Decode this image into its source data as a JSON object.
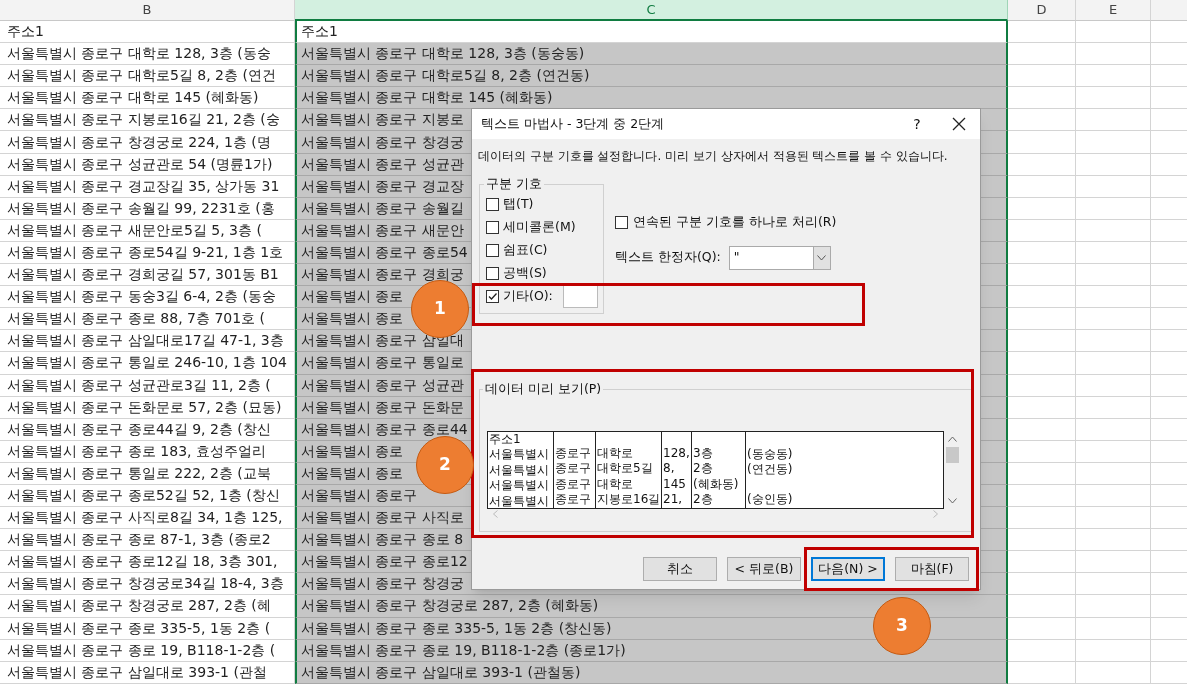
{
  "columns": [
    {
      "label": "B",
      "selected": false
    },
    {
      "label": "C",
      "selected": true
    },
    {
      "label": "D",
      "selected": false
    },
    {
      "label": "E",
      "selected": false
    }
  ],
  "header_row": {
    "b": "주소1",
    "c": "주소1"
  },
  "rows": [
    {
      "b": "서울특별시 종로구 대학로 128, 3층 (동숭",
      "c": "서울특별시 종로구 대학로 128, 3층 (동숭동)"
    },
    {
      "b": "서울특별시 종로구 대학로5길 8, 2층 (연건",
      "c": "서울특별시 종로구 대학로5길 8, 2층 (연건동)"
    },
    {
      "b": "서울특별시 종로구 대학로 145 (혜화동)",
      "c": "서울특별시 종로구 대학로 145 (혜화동)"
    },
    {
      "b": "서울특별시 종로구 지봉로16길 21, 2층 (숭",
      "c": "서울특별시 종로구 지봉로"
    },
    {
      "b": "서울특별시 종로구 창경궁로 224, 1층 (명",
      "c": "서울특별시 종로구 창경궁"
    },
    {
      "b": "서울특별시 종로구 성균관로 54 (명륜1가)",
      "c": "서울특별시 종로구 성균관"
    },
    {
      "b": "서울특별시 종로구 경교장길 35, 상가동 31",
      "c": "서울특별시 종로구 경교장"
    },
    {
      "b": "서울특별시 종로구 송월길 99, 2231호 (홍",
      "c": "서울특별시 종로구 송월길"
    },
    {
      "b": "서울특별시 종로구 새문안로5길 5, 3층 (",
      "c": "서울특별시 종로구 새문안"
    },
    {
      "b": "서울특별시 종로구 종로54길 9-21, 1층 1호",
      "c": "서울특별시 종로구 종로54"
    },
    {
      "b": "서울특별시 종로구 경희궁길 57, 301동 B1",
      "c": "서울특별시 종로구 경희궁"
    },
    {
      "b": "서울특별시 종로구 동숭3길 6-4, 2층 (동숭",
      "c": "서울특별시 종로"
    },
    {
      "b": "서울특별시 종로구 종로 88, 7층 701호 (",
      "c": "서울특별시 종로"
    },
    {
      "b": "서울특별시 종로구 삼일대로17길 47-1, 3층",
      "c": "서울특별시 종로구 삼일대"
    },
    {
      "b": "서울특별시 종로구 통일로 246-10, 1층 104",
      "c": "서울특별시 종로구 통일로"
    },
    {
      "b": "서울특별시 종로구 성균관로3길 11, 2층 (",
      "c": "서울특별시 종로구 성균관"
    },
    {
      "b": "서울특별시 종로구 돈화문로 57, 2층 (묘동)",
      "c": "서울특별시 종로구 돈화문"
    },
    {
      "b": "서울특별시 종로구 종로44길 9, 2층 (창신",
      "c": "서울특별시 종로구 종로44"
    },
    {
      "b": "서울특별시 종로구 종로 183, 효성주얼리",
      "c": "서울특별시 종로"
    },
    {
      "b": "서울특별시 종로구 통일로 222, 2층 (교북",
      "c": "서울특별시 종로"
    },
    {
      "b": "서울특별시 종로구 종로52길 52, 1층 (창신",
      "c": "서울특별시 종로구"
    },
    {
      "b": "서울특별시 종로구 사직로8길 34, 1층 125,",
      "c": "서울특별시 종로구 사직로"
    },
    {
      "b": "서울특별시 종로구 종로 87-1, 3층 (종로2",
      "c": "서울특별시 종로구 종로 8"
    },
    {
      "b": "서울특별시 종로구 종로12길 18, 3층 301,",
      "c": "서울특별시 종로구 종로12"
    },
    {
      "b": "서울특별시 종로구 창경궁로34길 18-4, 3층",
      "c": "서울특별시 종로구 창경궁"
    },
    {
      "b": "서울특별시 종로구 창경궁로 287, 2층 (혜",
      "c": "서울특별시 종로구 창경궁로 287, 2층 (혜화동)"
    },
    {
      "b": "서울특별시 종로구 종로 335-5, 1동 2층 (",
      "c": "서울특별시 종로구 종로 335-5, 1동 2층 (창신동)"
    },
    {
      "b": "서울특별시 종로구 종로 19, B118-1-2층 (",
      "c": "서울특별시 종로구 종로 19, B118-1-2층 (종로1가)"
    },
    {
      "b": "서울특별시 종로구 삼일대로 393-1 (관철",
      "c": "서울특별시 종로구 삼일대로 393-1 (관철동)"
    }
  ],
  "dialog": {
    "title": "텍스트 마법사 - 3단계 중 2단계",
    "help": "?",
    "description": "데이터의 구분 기호를 설정합니다. 미리 보기 상자에서 적용된 텍스트를 볼 수 있습니다.",
    "delimiters": {
      "legend": "구분 기호",
      "options": [
        {
          "label": "탭(T)",
          "checked": false,
          "kind": "plain"
        },
        {
          "label": "세미콜론(M)",
          "checked": false,
          "kind": "plain"
        },
        {
          "label": "쉼표(C)",
          "checked": false,
          "kind": "plain"
        },
        {
          "label": "공백(S)",
          "checked": false,
          "kind": "plain"
        },
        {
          "label": "기타(O):",
          "checked": true,
          "kind": "with_field"
        }
      ]
    },
    "consecutive": {
      "label": "연속된 구분 기호를 하나로 처리(R)",
      "checked": false
    },
    "qualifier": {
      "label": "텍스트 한정자(Q):",
      "value": "\""
    },
    "preview": {
      "legend": "데이터 미리 보기(P)",
      "rows": [
        [
          "주소1"
        ],
        [
          "서울특별시",
          "종로구",
          "대학로",
          "128,",
          "3층",
          "(동숭동)"
        ],
        [
          "서울특별시",
          "종로구",
          "대학로5길",
          "8,",
          "2층",
          "(연건동)"
        ],
        [
          "서울특별시",
          "종로구",
          "대학로",
          "145",
          "(혜화동)"
        ],
        [
          "서울특별시",
          "종로구",
          "지봉로16길",
          "21,",
          "2층",
          "(숭인동)"
        ]
      ]
    },
    "buttons": [
      {
        "label": "취소",
        "default": false
      },
      {
        "label": "< 뒤로(B)",
        "default": false
      },
      {
        "label": "다음(N) >",
        "default": true
      },
      {
        "label": "마침(F)",
        "default": false
      }
    ]
  },
  "callouts": [
    "1",
    "2",
    "3"
  ]
}
